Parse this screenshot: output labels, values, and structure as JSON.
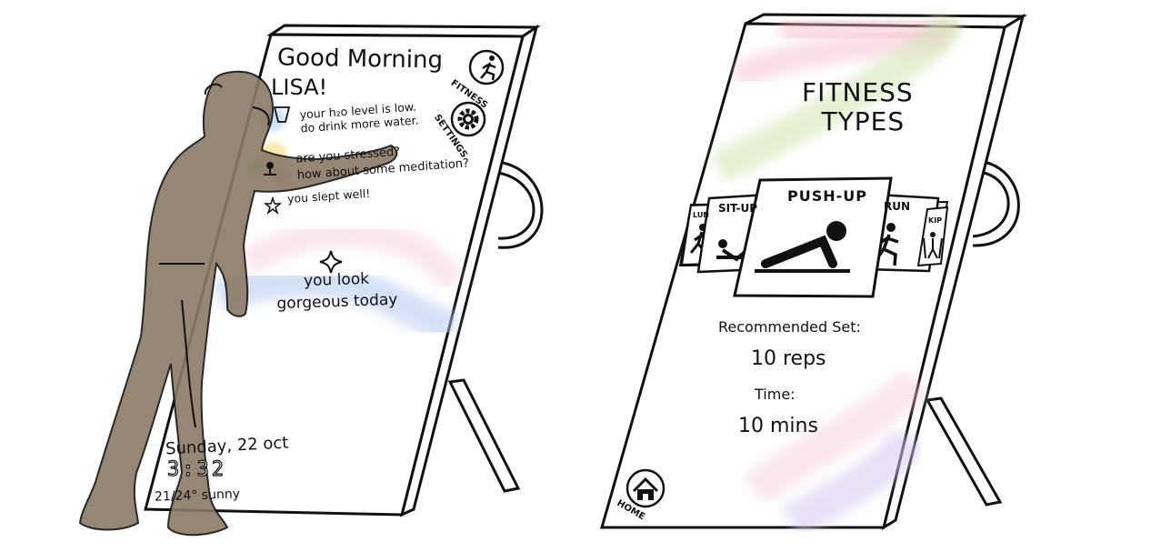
{
  "left_mirror": {
    "greeting_line1": "Good Morning",
    "greeting_line2": "LISA!",
    "messages": [
      {
        "line1": "your h₂o level is low.",
        "line2": "do drink more water."
      },
      {
        "line1": "are you stressed?",
        "line2": "how about some meditation?"
      },
      {
        "line1": "you slept well!",
        "line2": ""
      }
    ],
    "compliment_line1": "you look",
    "compliment_line2": "gorgeous today",
    "date": "Sunday, 22 oct",
    "time": "3:32",
    "weather": "21/24° sunny",
    "side_buttons": [
      {
        "label": "FITNESS",
        "icon": "running-person-icon"
      },
      {
        "label": "SETTINGS",
        "icon": "gear-icon"
      }
    ]
  },
  "right_mirror": {
    "title_line1": "FITNESS",
    "title_line2": "TYPES",
    "carousel": [
      {
        "label": "LUN",
        "icon": "lunge-icon"
      },
      {
        "label": "SIT-UP",
        "icon": "sit-up-icon"
      },
      {
        "label": "PUSH-UP",
        "icon": "push-up-icon",
        "selected": true
      },
      {
        "label": "RUN",
        "icon": "running-person-icon"
      },
      {
        "label": "KIP",
        "icon": "skipping-rope-icon"
      }
    ],
    "recommended_label": "Recommended Set:",
    "reps": "10 reps",
    "time_label": "Time:",
    "time_value": "10 mins",
    "home_label": "HOME"
  }
}
